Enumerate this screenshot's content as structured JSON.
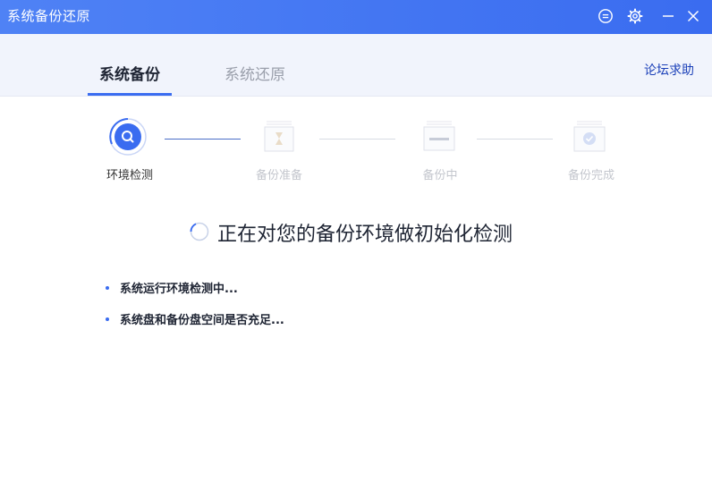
{
  "window": {
    "title": "系统备份还原",
    "accent_color": "#3a6cf0"
  },
  "titlebar": {
    "feedback_icon": "feedback-icon",
    "settings_icon": "gear-icon",
    "minimize_icon": "minimize-icon",
    "close_icon": "close-icon"
  },
  "tabs": [
    {
      "label": "系统备份",
      "active": true
    },
    {
      "label": "系统还原",
      "active": false
    }
  ],
  "forum_link": "论坛求助",
  "steps": [
    {
      "label": "环境检测",
      "state": "active",
      "icon": "search-icon"
    },
    {
      "label": "备份准备",
      "state": "pending",
      "icon": "hourglass-icon"
    },
    {
      "label": "备份中",
      "state": "pending",
      "icon": "progress-icon"
    },
    {
      "label": "备份完成",
      "state": "pending",
      "icon": "check-icon"
    }
  ],
  "status": {
    "text": "正在对您的备份环境做初始化检测"
  },
  "checks": [
    {
      "text": "系统运行环境检测中..."
    },
    {
      "text": "系统盘和备份盘空间是否充足..."
    }
  ]
}
